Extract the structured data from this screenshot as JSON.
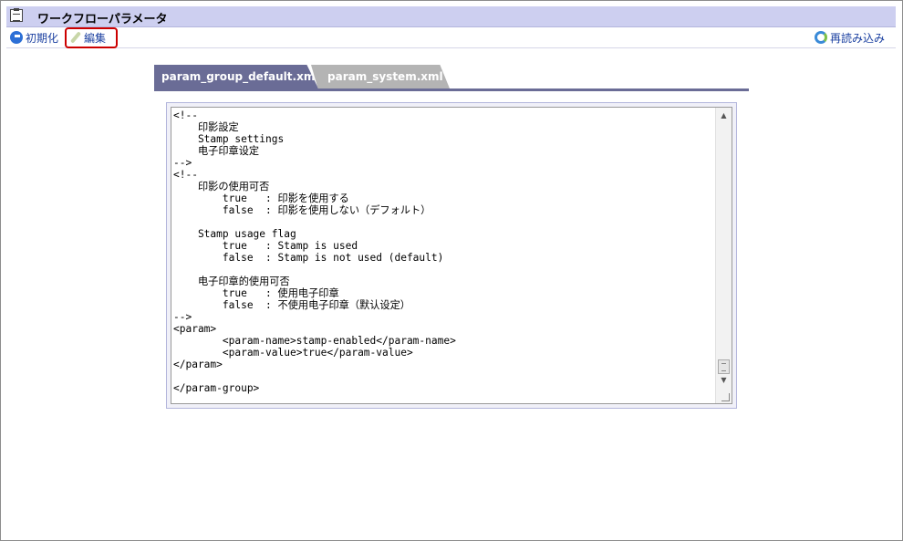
{
  "window": {
    "title": "ワークフローパラメータ"
  },
  "toolbar": {
    "init_label": "初期化",
    "edit_label": "編集",
    "reload_label": "再読み込み"
  },
  "tabs": [
    {
      "label": "param_group_default.xml",
      "active": true
    },
    {
      "label": "param_system.xml",
      "active": false
    }
  ],
  "editor": {
    "content": "<!--\n    印影設定\n    Stamp settings\n    电子印章设定\n-->\n<!--\n    印影の使用可否\n        true   : 印影を使用する\n        false  : 印影を使用しない（デフォルト）\n\n    Stamp usage flag\n        true   : Stamp is used\n        false  : Stamp is not used (default)\n\n    电子印章的使用可否\n        true   : 使用电子印章\n        false  : 不使用电子印章（默认设定）\n-->\n<param>\n        <param-name>stamp-enabled</param-name>\n        <param-value>true</param-value>\n</param>\n\n</param-group>"
  },
  "icons": {
    "title": "clipboard-icon",
    "init": "refresh-g-icon",
    "edit": "pen-icon",
    "reload": "reload-icon"
  },
  "colors": {
    "titlebar": "#cdcff0",
    "tab_active": "#6a6c96",
    "tab_inactive": "#b4b4b4",
    "link": "#1a3fa0",
    "highlight": "#cc0000"
  }
}
